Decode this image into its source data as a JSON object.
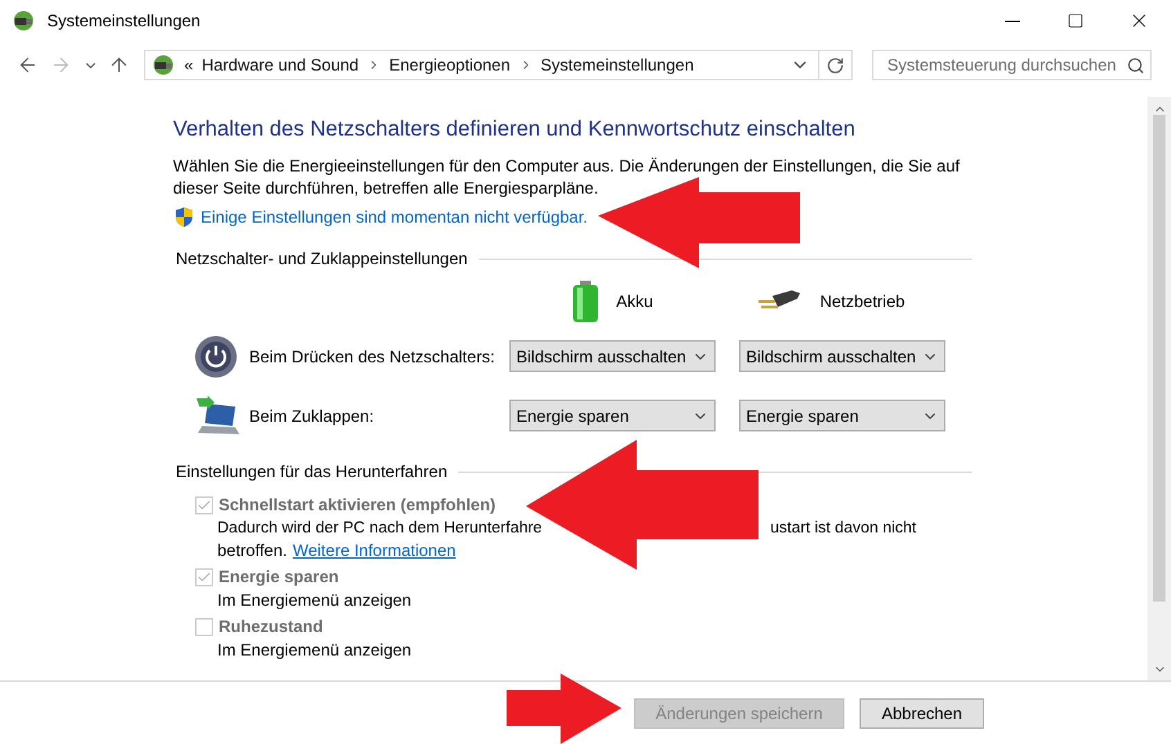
{
  "window": {
    "title": "Systemeinstellungen"
  },
  "address_bar": {
    "overflow": "«",
    "breadcrumbs": [
      "Hardware und Sound",
      "Energieoptionen",
      "Systemeinstellungen"
    ]
  },
  "search": {
    "placeholder": "Systemsteuerung durchsuchen"
  },
  "page": {
    "heading": "Verhalten des Netzschalters definieren und Kennwortschutz einschalten",
    "intro": "Wählen Sie die Energieeinstellungen für den Computer aus. Die Änderungen der Einstellungen, die Sie auf dieser Seite durchführen, betreffen alle Energiesparpläne.",
    "admin_link": "Einige Einstellungen sind momentan nicht verfügbar."
  },
  "power_section": {
    "title": "Netzschalter- und Zuklappeinstellungen",
    "columns": [
      {
        "kind": "battery",
        "label": "Akku"
      },
      {
        "kind": "plug",
        "label": "Netzbetrieb"
      }
    ],
    "rows": [
      {
        "kind": "power-button",
        "label": "Beim Drücken des Netzschalters:",
        "values": [
          "Bildschirm ausschalten",
          "Bildschirm ausschalten"
        ]
      },
      {
        "kind": "lid",
        "label": "Beim Zuklappen:",
        "values": [
          "Energie sparen",
          "Energie sparen"
        ]
      }
    ]
  },
  "shutdown_section": {
    "title": "Einstellungen für das Herunterfahren",
    "options": [
      {
        "label": "Schnellstart aktivieren (empfohlen)",
        "checked": true,
        "disabled": true,
        "description_start": "Dadurch wird der PC nach dem Herunterfahre",
        "description_end": "ustart ist davon nicht",
        "description_more": "betroffen.",
        "link": "Weitere Informationen"
      },
      {
        "label": "Energie sparen",
        "checked": true,
        "disabled": true,
        "description_start": "Im Energiemenü anzeigen"
      },
      {
        "label": "Ruhezustand",
        "checked": false,
        "disabled": true,
        "description_start": "Im Energiemenü anzeigen"
      }
    ]
  },
  "buttons": [
    {
      "label": "Änderungen speichern",
      "disabled": true
    },
    {
      "label": "Abbrechen",
      "disabled": false
    }
  ]
}
